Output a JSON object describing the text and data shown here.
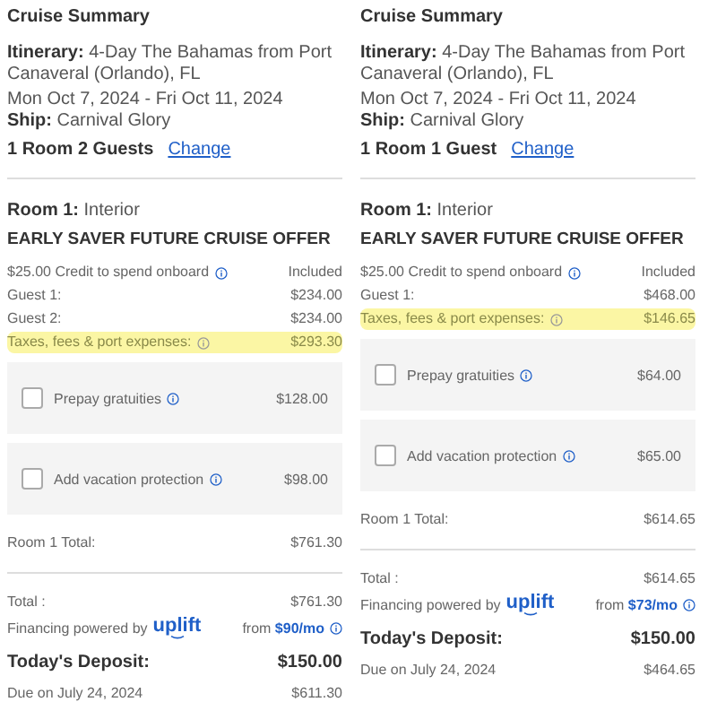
{
  "panels": [
    {
      "title": "Cruise Summary",
      "itinerary_label": "Itinerary:",
      "itinerary": "4-Day The Bahamas from Port Canaveral (Orlando), FL",
      "dates": "Mon Oct 7, 2024 - Fri Oct 11, 2024",
      "ship_label": "Ship:",
      "ship": "Carnival Glory",
      "occupancy": "1 Room 2 Guests",
      "change_link": "Change",
      "room_label": "Room 1:",
      "room_type": "Interior",
      "offer": "EARLY SAVER FUTURE CRUISE OFFER",
      "line_items": [
        {
          "label": "$25.00 Credit to spend onboard",
          "info": true,
          "amount": "Included",
          "highlighted": false
        },
        {
          "label": "Guest 1:",
          "info": false,
          "amount": "$234.00",
          "highlighted": false
        },
        {
          "label": "Guest 2:",
          "info": false,
          "amount": "$234.00",
          "highlighted": false
        },
        {
          "label": "Taxes, fees & port expenses:",
          "info": true,
          "amount": "$293.30",
          "highlighted": true
        }
      ],
      "addons": [
        {
          "label": "Prepay gratuities",
          "checked": false,
          "amount": "$128.00"
        },
        {
          "label": "Add vacation protection",
          "checked": false,
          "amount": "$98.00"
        }
      ],
      "room_total": {
        "label": "Room 1 Total:",
        "amount": "$761.30"
      },
      "total": {
        "label": "Total :",
        "amount": "$761.30"
      },
      "financing": {
        "label": "Financing powered by",
        "brand": "uplift",
        "prefix": "from",
        "rate": "$90/mo"
      },
      "deposit": {
        "label": "Today's Deposit:",
        "amount": "$150.00"
      },
      "due": {
        "label": "Due on July 24, 2024",
        "amount": "$611.30"
      }
    },
    {
      "title": "Cruise Summary",
      "itinerary_label": "Itinerary:",
      "itinerary": "4-Day The Bahamas from Port Canaveral (Orlando), FL",
      "dates": "Mon Oct 7, 2024 - Fri Oct 11, 2024",
      "ship_label": "Ship:",
      "ship": "Carnival Glory",
      "occupancy": "1 Room 1 Guest",
      "change_link": "Change",
      "room_label": "Room 1:",
      "room_type": "Interior",
      "offer": "EARLY SAVER FUTURE CRUISE OFFER",
      "line_items": [
        {
          "label": "$25.00 Credit to spend onboard",
          "info": true,
          "amount": "Included",
          "highlighted": false
        },
        {
          "label": "Guest 1:",
          "info": false,
          "amount": "$468.00",
          "highlighted": false
        },
        {
          "label": "Taxes, fees & port expenses:",
          "info": true,
          "amount": "$146.65",
          "highlighted": true
        }
      ],
      "addons": [
        {
          "label": "Prepay gratuities",
          "checked": false,
          "amount": "$64.00"
        },
        {
          "label": "Add vacation protection",
          "checked": false,
          "amount": "$65.00"
        }
      ],
      "room_total": {
        "label": "Room 1 Total:",
        "amount": "$614.65"
      },
      "total": {
        "label": "Total :",
        "amount": "$614.65"
      },
      "financing": {
        "label": "Financing powered by",
        "brand": "uplift",
        "prefix": "from",
        "rate": "$73/mo"
      },
      "deposit": {
        "label": "Today's Deposit:",
        "amount": "$150.00"
      },
      "due": {
        "label": "Due on July 24, 2024",
        "amount": "$464.65"
      }
    }
  ]
}
